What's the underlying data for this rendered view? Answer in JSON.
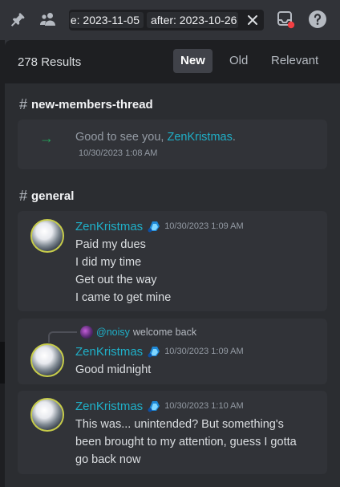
{
  "toolbar": {
    "icons": [
      "pin-icon",
      "members-icon",
      "close-icon",
      "inbox-icon",
      "help-icon"
    ],
    "search": {
      "before_chip": "e: 2023-11-05",
      "after_chip": "after: 2023-10-26"
    }
  },
  "results": {
    "count_label": "278 Results",
    "sort_tabs": [
      "New",
      "Old",
      "Relevant"
    ],
    "active_sort": "New"
  },
  "groups": [
    {
      "channel": "new-members-thread",
      "system_message": {
        "text_prefix": "Good to see you, ",
        "mention": "ZenKristmas",
        "text_suffix": ".",
        "timestamp": "10/30/2023 1:08 AM"
      }
    },
    {
      "channel": "general",
      "messages": [
        {
          "author": "ZenKristmas",
          "timestamp": "10/30/2023 1:09 AM",
          "lines": [
            "Paid my dues",
            "I did my time",
            "Get out the way",
            "I came to get mine"
          ]
        },
        {
          "reply": {
            "mention": "@noisy",
            "text": "welcome back"
          },
          "author": "ZenKristmas",
          "timestamp": "10/30/2023 1:09 AM",
          "lines": [
            "Good midnight"
          ]
        },
        {
          "author": "ZenKristmas",
          "timestamp": "10/30/2023 1:10 AM",
          "lines": [
            "This was... unintended? But something's",
            "been brought to my attention, guess I gotta",
            "go back now"
          ]
        }
      ]
    }
  ],
  "colors": {
    "accent_mention": "#1fb0c8",
    "system_arrow": "#23a55a",
    "panel_bg": "#2b2d31",
    "card_bg": "#313338"
  }
}
